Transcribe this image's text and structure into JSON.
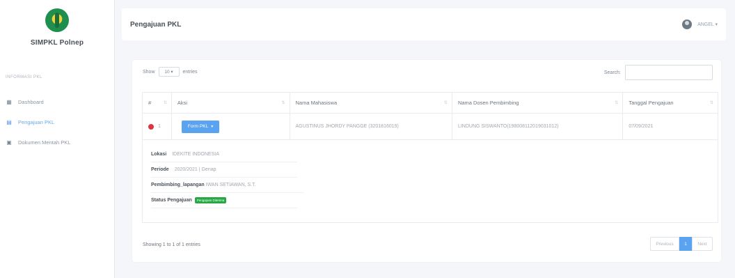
{
  "sidebar": {
    "brand": "SIMPKL Polnep",
    "heading": "INFORMASI PKL",
    "items": [
      {
        "label": "Dashboard",
        "icon": "dashboard-icon"
      },
      {
        "label": "Pengajuan PKL",
        "icon": "document-icon"
      },
      {
        "label": "Dokumen Mentah PKL",
        "icon": "folder-icon"
      }
    ]
  },
  "header": {
    "title": "Pengajuan PKL",
    "user": "ANGEL ▾"
  },
  "table_controls": {
    "show": "Show",
    "length_value": "10 ▾",
    "entries": "entries",
    "search_label": "Search:"
  },
  "table": {
    "columns": [
      "#",
      "Aksi",
      "Nama Mahasiswa",
      "Nama Dosen Pembimbing",
      "Tanggal Pengajuan"
    ],
    "rows": [
      {
        "no": "1",
        "action": "Form PKL",
        "student": "AGUSTINUS JHORDY PANGGE (3201816019)",
        "lecturer": "LINDUNG SISWANTO(198008112019031012)",
        "date": "07/09/2021"
      }
    ]
  },
  "detail": {
    "lokasi_label": "Lokasi",
    "lokasi_value": "IDEKITE INDONESIA",
    "periode_label": "Periode",
    "periode_value": "2020/2021 | Genap",
    "pembimbing_label": "Pembimbing_lapangan",
    "pembimbing_value": "IWAN SETIAWAN, S.T.",
    "status_label": "Status Pengajuan",
    "status_badge": "Pengajuan Diterima"
  },
  "footer": {
    "info": "Showing 1 to 1 of 1 entries",
    "prev": "Previous",
    "page": "1",
    "next": "Next"
  },
  "colors": {
    "primary": "#5aa3f0",
    "danger": "#dc3545",
    "success": "#28a745"
  }
}
